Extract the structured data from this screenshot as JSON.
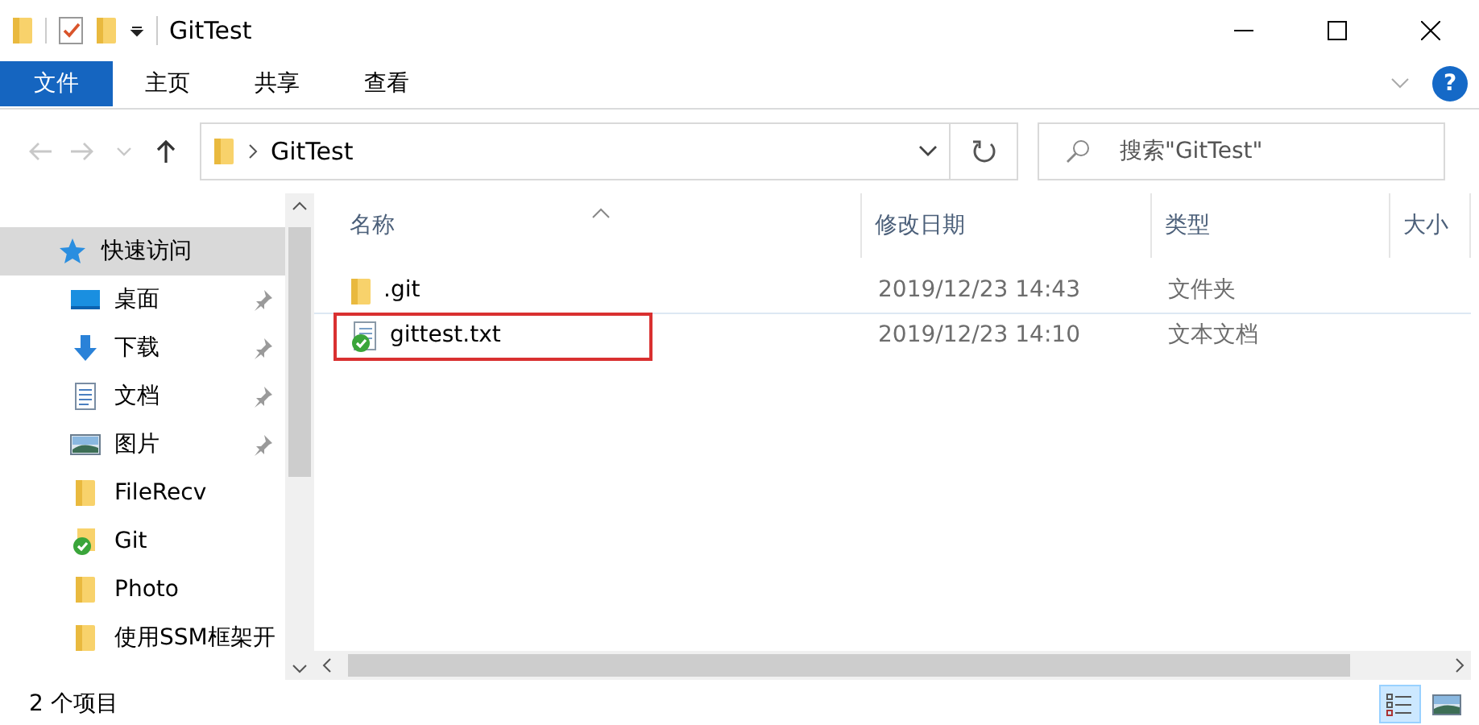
{
  "window": {
    "title": "GitTest"
  },
  "ribbon_tabs": [
    {
      "label": "文件",
      "selected": true
    },
    {
      "label": "主页",
      "selected": false
    },
    {
      "label": "共享",
      "selected": false
    },
    {
      "label": "查看",
      "selected": false
    }
  ],
  "help": "?",
  "navigation": [
    {
      "kind": "back",
      "disabled": true
    },
    {
      "kind": "forward",
      "disabled": true
    },
    {
      "kind": "recent",
      "disabled": true
    },
    {
      "kind": "up",
      "disabled": false
    }
  ],
  "address": {
    "path": [
      "GitTest"
    ]
  },
  "search": {
    "placeholder": "搜索\"GitTest\""
  },
  "sidebar": {
    "items": [
      {
        "label": "快速访问",
        "kind": "star",
        "selected": true,
        "children": [
          {
            "label": "桌面",
            "kind": "desktop",
            "selected": false,
            "pinned": true
          },
          {
            "label": "下载",
            "kind": "download",
            "selected": false,
            "pinned": true
          },
          {
            "label": "文档",
            "kind": "document",
            "selected": false,
            "pinned": true
          },
          {
            "label": "图片",
            "kind": "pictures",
            "selected": false,
            "pinned": true
          },
          {
            "label": "FileRecv",
            "kind": "folder",
            "selected": false,
            "pinned": false
          },
          {
            "label": "Git",
            "kind": "repo",
            "selected": false,
            "pinned": false
          },
          {
            "label": "Photo",
            "kind": "folder",
            "selected": false,
            "pinned": false
          },
          {
            "label": "使用SSM框架开",
            "kind": "folder",
            "selected": false,
            "pinned": false
          }
        ]
      }
    ]
  },
  "table": {
    "columns": [
      {
        "label": "名称",
        "sorted": true
      },
      {
        "label": "修改日期",
        "sorted": false
      },
      {
        "label": "类型",
        "sorted": false
      },
      {
        "label": "大小",
        "sorted": false
      }
    ],
    "rows": [
      {
        "name": ".git",
        "kind": "folder",
        "modified": "2019/12/23 14:43",
        "type": "文件夹",
        "highlighted": false
      },
      {
        "name": "gittest.txt",
        "kind": "tracked-file",
        "modified": "2019/12/23 14:10",
        "type": "文本文档",
        "highlighted": true
      }
    ]
  },
  "status_bar": {
    "item_count": "2 个项目",
    "views": [
      {
        "kind": "details",
        "selected": true
      },
      {
        "kind": "large-icons",
        "selected": false
      }
    ]
  }
}
